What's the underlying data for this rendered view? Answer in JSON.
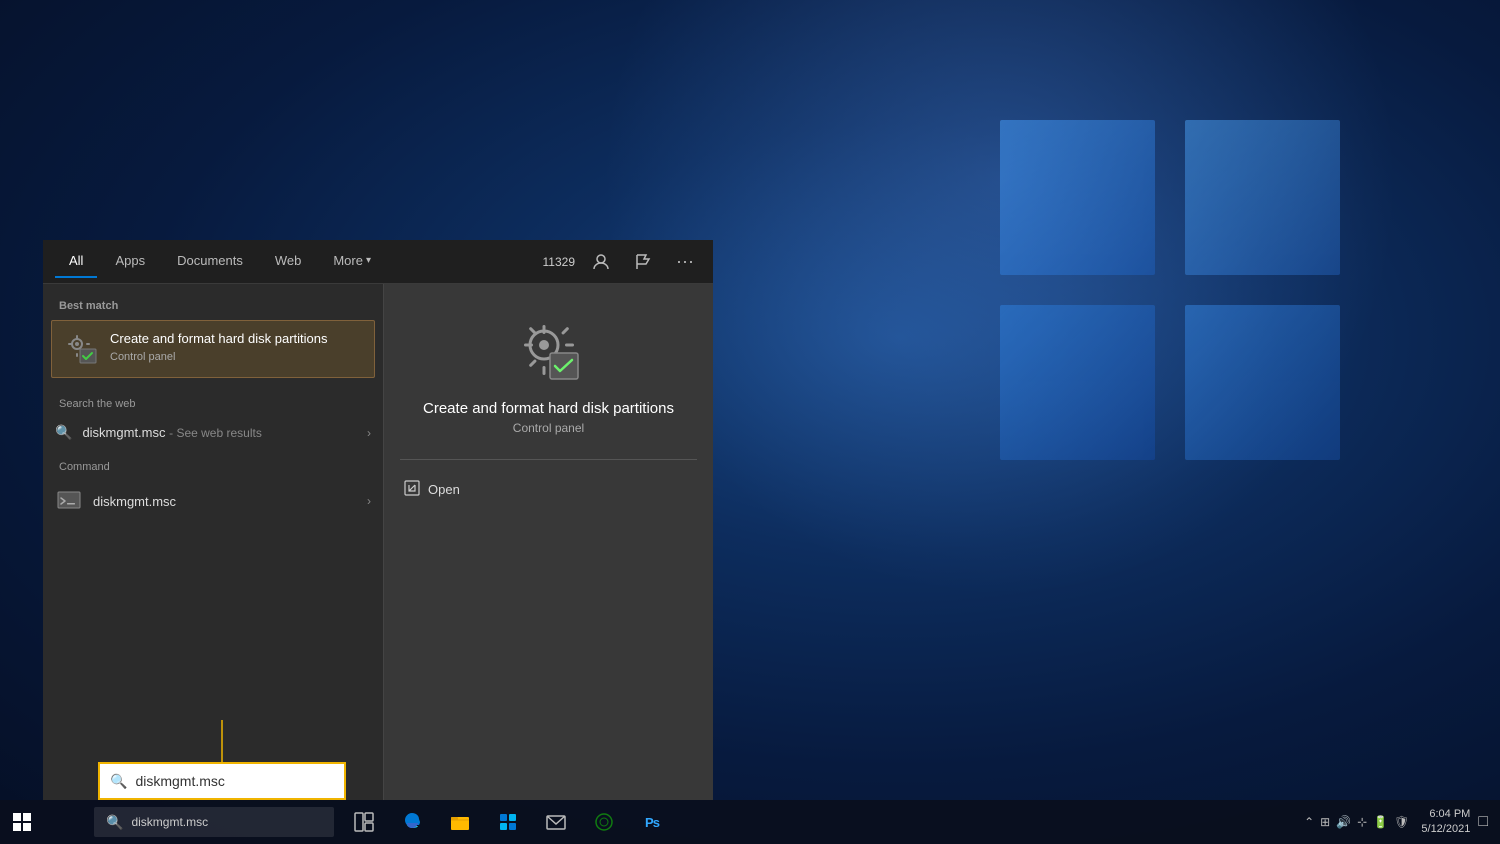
{
  "desktop": {
    "background": "Windows 10 desktop"
  },
  "taskbar": {
    "search_placeholder": "diskmgmt.msc",
    "search_text": "diskmgmt.msc",
    "time": "6:04 PM",
    "date": "5/12/2021",
    "counter": "11329"
  },
  "search_popup": {
    "tabs": [
      {
        "label": "All",
        "active": true
      },
      {
        "label": "Apps",
        "active": false
      },
      {
        "label": "Documents",
        "active": false
      },
      {
        "label": "Web",
        "active": false
      },
      {
        "label": "More",
        "active": false,
        "has_arrow": true
      }
    ],
    "best_match_label": "Best match",
    "best_match": {
      "title": "Create and format hard disk partitions",
      "subtitle": "Control panel"
    },
    "search_web_label": "Search the web",
    "web_result": {
      "text": "diskmgmt.msc",
      "sub": "- See web results"
    },
    "command_label": "Command",
    "command": {
      "text": "diskmgmt.msc"
    },
    "right_pane": {
      "title": "Create and format hard disk partitions",
      "subtitle": "Control panel",
      "open_label": "Open"
    }
  }
}
